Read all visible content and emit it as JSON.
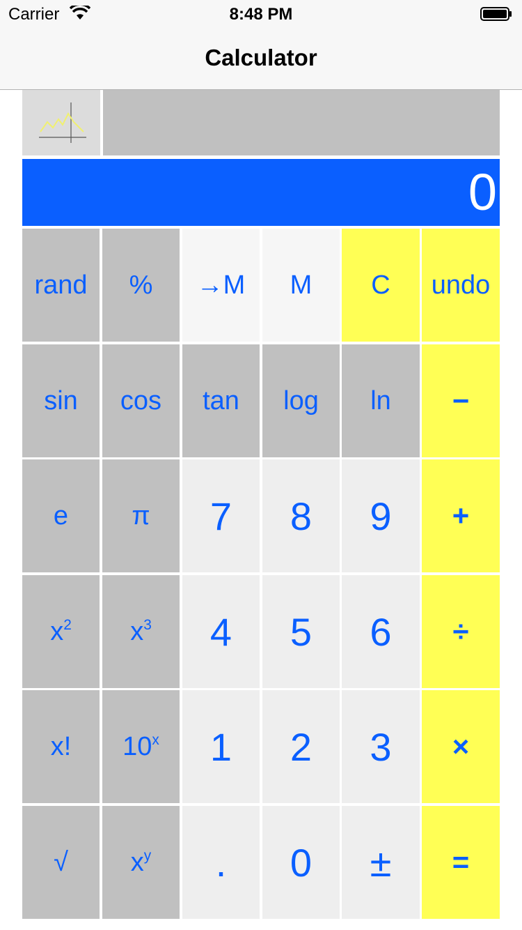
{
  "status_bar": {
    "carrier": "Carrier",
    "time": "8:48 PM"
  },
  "nav": {
    "title": "Calculator"
  },
  "description": "",
  "display": {
    "value": "0"
  },
  "colors": {
    "accent": "#0a5fff",
    "display_bg": "#0a5fff",
    "function_key": "#c0c0c0",
    "digit_key": "#eeeeee",
    "memory_key": "#f6f6f6",
    "operator_key": "#ffff55"
  },
  "keys": [
    {
      "id": "rand",
      "label": "rand"
    },
    {
      "id": "percent",
      "label": "%"
    },
    {
      "id": "store-memory",
      "label": "→M"
    },
    {
      "id": "memory",
      "label": "M"
    },
    {
      "id": "clear",
      "label": "C"
    },
    {
      "id": "undo",
      "label": "undo"
    },
    {
      "id": "sin",
      "label": "sin"
    },
    {
      "id": "cos",
      "label": "cos"
    },
    {
      "id": "tan",
      "label": "tan"
    },
    {
      "id": "log",
      "label": "log"
    },
    {
      "id": "ln",
      "label": "ln"
    },
    {
      "id": "minus",
      "label": "−"
    },
    {
      "id": "e",
      "label": "e"
    },
    {
      "id": "pi",
      "label": "π"
    },
    {
      "id": "digit-7",
      "label": "7"
    },
    {
      "id": "digit-8",
      "label": "8"
    },
    {
      "id": "digit-9",
      "label": "9"
    },
    {
      "id": "plus",
      "label": "+"
    },
    {
      "id": "square",
      "label": "x",
      "sup": "2"
    },
    {
      "id": "cube",
      "label": "x",
      "sup": "3"
    },
    {
      "id": "digit-4",
      "label": "4"
    },
    {
      "id": "digit-5",
      "label": "5"
    },
    {
      "id": "digit-6",
      "label": "6"
    },
    {
      "id": "divide",
      "label": "÷"
    },
    {
      "id": "factorial",
      "label": "x!"
    },
    {
      "id": "ten-power",
      "label": "10",
      "sup": "x"
    },
    {
      "id": "digit-1",
      "label": "1"
    },
    {
      "id": "digit-2",
      "label": "2"
    },
    {
      "id": "digit-3",
      "label": "3"
    },
    {
      "id": "multiply",
      "label": "×"
    },
    {
      "id": "sqrt",
      "label": "√"
    },
    {
      "id": "power",
      "label": "x",
      "sup": "y"
    },
    {
      "id": "decimal",
      "label": "."
    },
    {
      "id": "digit-0",
      "label": "0"
    },
    {
      "id": "sign",
      "label": "±"
    },
    {
      "id": "equals",
      "label": "="
    }
  ]
}
